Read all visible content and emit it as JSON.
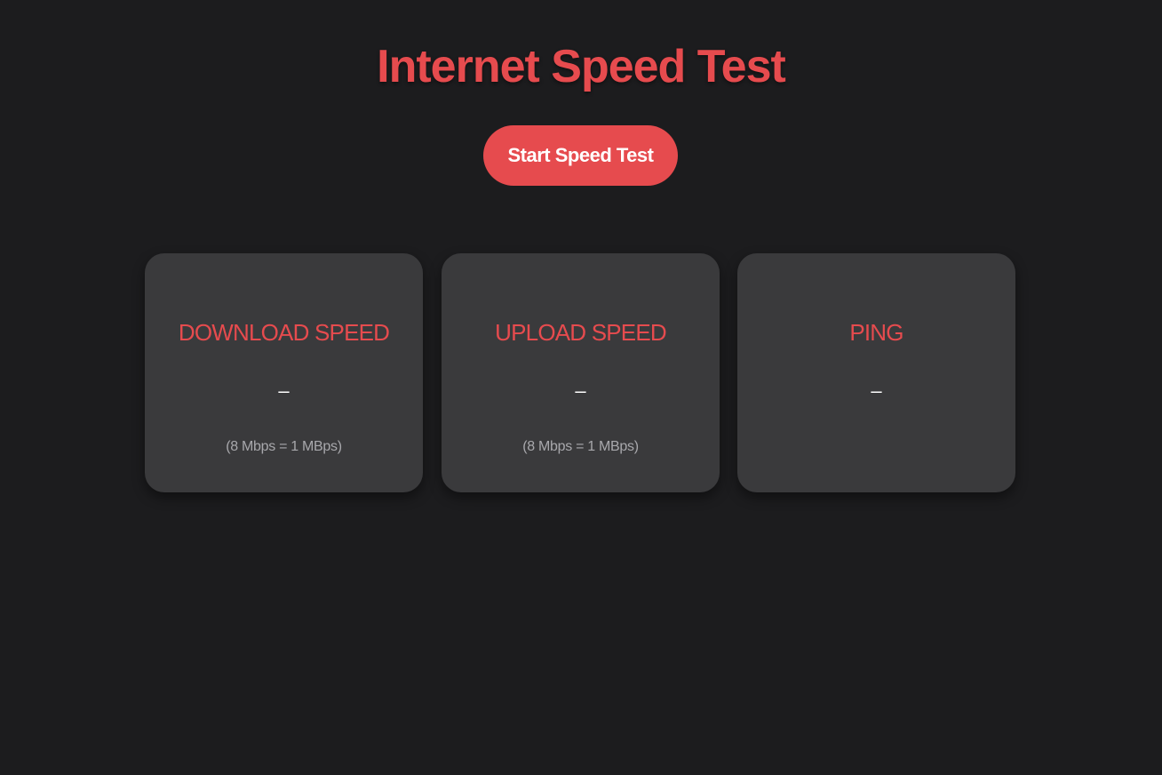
{
  "header": {
    "title": "Internet Speed Test"
  },
  "controls": {
    "start_label": "Start Speed Test"
  },
  "cards": [
    {
      "label": "DOWNLOAD SPEED",
      "value": "–",
      "note": "(8 Mbps = 1 MBps)"
    },
    {
      "label": "UPLOAD SPEED",
      "value": "–",
      "note": "(8 Mbps = 1 MBps)"
    },
    {
      "label": "PING",
      "value": "–"
    }
  ],
  "colors": {
    "accent": "#e64b4e",
    "background": "#1c1c1e",
    "card": "#3a3a3c",
    "note": "#a8a8ac"
  }
}
